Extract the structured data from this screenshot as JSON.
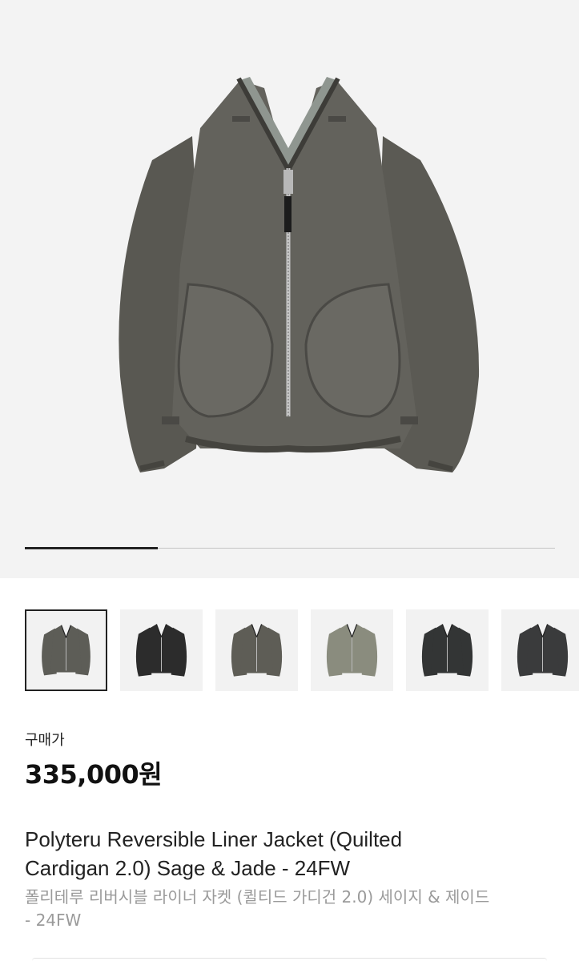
{
  "product": {
    "hero_image": "reversible-liner-jacket-sage-front",
    "gallery_progress": 0.25,
    "thumbnails": [
      {
        "image": "jacket-sage-front",
        "selected": true,
        "color": "#5d5d57"
      },
      {
        "image": "jacket-black-front",
        "selected": false,
        "color": "#2c2c2c"
      },
      {
        "image": "jacket-sage-front-alt",
        "selected": false,
        "color": "#5e5d56"
      },
      {
        "image": "jacket-jade-quilted-front",
        "selected": false,
        "color": "#8a8c7e"
      },
      {
        "image": "jacket-black-quilted-front",
        "selected": false,
        "color": "#333535"
      },
      {
        "image": "jacket-black-quilted-angle",
        "selected": false,
        "color": "#3a3b3c"
      }
    ],
    "price_label": "구매가",
    "price": "335,000원",
    "title_en_line1": "Polyteru Reversible Liner Jacket (Quilted",
    "title_en_line2": "Cardigan 2.0) Sage & Jade - 24FW",
    "title_ko_line1": "폴리테루 리버시블 라이너 자켓 (퀼티드 가디건 2.0) 세이지 & 제이드",
    "title_ko_line2": "- 24FW"
  },
  "colors": {
    "hero_background": "#f3f3f3",
    "jacket_body": "#5d5c56",
    "progress_fill": "#222222"
  }
}
